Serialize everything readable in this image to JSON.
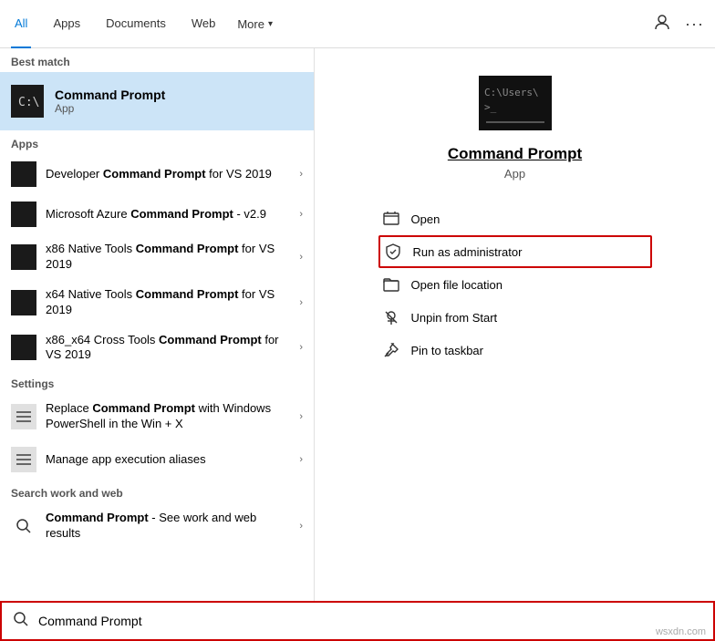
{
  "nav": {
    "tabs": [
      {
        "label": "All",
        "active": true
      },
      {
        "label": "Apps",
        "active": false
      },
      {
        "label": "Documents",
        "active": false
      },
      {
        "label": "Web",
        "active": false
      },
      {
        "label": "More",
        "active": false,
        "hasChevron": true
      }
    ],
    "icons": {
      "person": "👤",
      "more": "···"
    }
  },
  "left": {
    "best_match_header": "Best match",
    "best_match": {
      "title": "Command Prompt",
      "subtitle": "App"
    },
    "apps_header": "Apps",
    "apps": [
      {
        "pre": "Developer ",
        "bold": "Command Prompt",
        "post": " for VS 2019"
      },
      {
        "pre": "Microsoft Azure ",
        "bold": "Command Prompt",
        "post": " - v2.9"
      },
      {
        "pre": "x86 Native Tools ",
        "bold": "Command Prompt",
        "post": " for VS 2019"
      },
      {
        "pre": "x64 Native Tools ",
        "bold": "Command Prompt",
        "post": " for VS 2019"
      },
      {
        "pre": "x86_x64 Cross Tools ",
        "bold": "Command Prompt",
        "post": " for VS 2019"
      }
    ],
    "settings_header": "Settings",
    "settings": [
      {
        "pre": "Replace ",
        "bold": "Command Prompt",
        "post": " with Windows PowerShell in the Win + X"
      },
      {
        "pre": "Manage app execution aliases",
        "bold": "",
        "post": ""
      }
    ],
    "search_web_header": "Search work and web",
    "search_web": [
      {
        "pre": "",
        "bold": "Command Prompt",
        "post": " - See work and web results"
      }
    ]
  },
  "right": {
    "app_title": "Command Prompt",
    "app_subtitle": "App",
    "actions": [
      {
        "label": "Open",
        "icon": "open"
      },
      {
        "label": "Run as administrator",
        "icon": "shield",
        "highlighted": true
      },
      {
        "label": "Open file location",
        "icon": "folder"
      },
      {
        "label": "Unpin from Start",
        "icon": "unpin"
      },
      {
        "label": "Pin to taskbar",
        "icon": "pin"
      }
    ]
  },
  "search": {
    "value": "Command Prompt",
    "placeholder": "Command Prompt",
    "watermark": "wsxdn.com"
  }
}
